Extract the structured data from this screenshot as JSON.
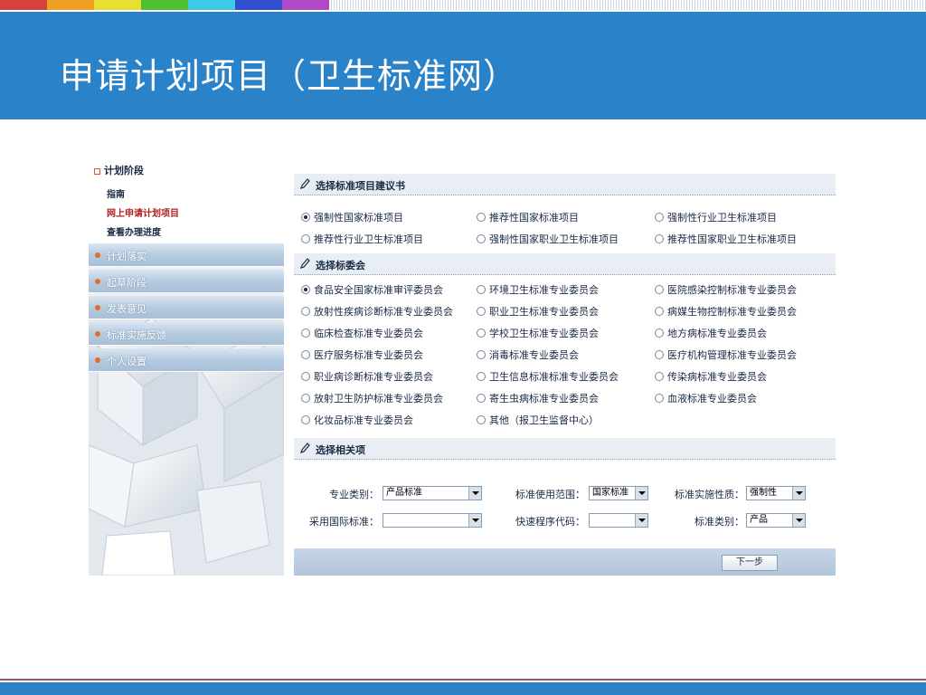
{
  "colors": {
    "header_bg": "#2a82c9",
    "strip": [
      "#d84040",
      "#f0a020",
      "#e8e030",
      "#50c030",
      "#40c8e8",
      "#3050d0",
      "#b048c8"
    ]
  },
  "slide": {
    "title": "申请计划项目（卫生标准网）"
  },
  "nav": {
    "heading": "计划阶段",
    "sub_items": [
      {
        "label": "指南",
        "active": false
      },
      {
        "label": "网上申请计划项目",
        "active": true
      },
      {
        "label": "查看办理进度",
        "active": false
      }
    ],
    "groups": [
      "计划落实",
      "起草阶段",
      "发表意见",
      "标准实施反馈",
      "个人设置"
    ]
  },
  "form": {
    "section1": {
      "title": "选择标准项目建议书",
      "options": [
        {
          "label": "强制性国家标准项目",
          "checked": true
        },
        {
          "label": "推荐性国家标准项目",
          "checked": false
        },
        {
          "label": "强制性行业卫生标准项目",
          "checked": false
        },
        {
          "label": "推荐性行业卫生标准项目",
          "checked": false
        },
        {
          "label": "强制性国家职业卫生标准项目",
          "checked": false
        },
        {
          "label": "推荐性国家职业卫生标准项目",
          "checked": false
        }
      ]
    },
    "section2": {
      "title": "选择标委会",
      "options": [
        {
          "label": "食品安全国家标准审评委员会",
          "checked": true
        },
        {
          "label": "环境卫生标准专业委员会",
          "checked": false
        },
        {
          "label": "医院感染控制标准专业委员会",
          "checked": false
        },
        {
          "label": "放射性疾病诊断标准专业委员会",
          "checked": false
        },
        {
          "label": "职业卫生标准专业委员会",
          "checked": false
        },
        {
          "label": "病媒生物控制标准专业委员会",
          "checked": false
        },
        {
          "label": "临床检查标准专业委员会",
          "checked": false
        },
        {
          "label": "学校卫生标准专业委员会",
          "checked": false
        },
        {
          "label": "地方病标准专业委员会",
          "checked": false
        },
        {
          "label": "医疗服务标准专业委员会",
          "checked": false
        },
        {
          "label": "消毒标准专业委员会",
          "checked": false
        },
        {
          "label": "医疗机构管理标准专业委员会",
          "checked": false
        },
        {
          "label": "职业病诊断标准专业委员会",
          "checked": false
        },
        {
          "label": "卫生信息标准标准专业委员会",
          "checked": false
        },
        {
          "label": "传染病标准专业委员会",
          "checked": false
        },
        {
          "label": "放射卫生防护标准专业委员会",
          "checked": false
        },
        {
          "label": "寄生虫病标准专业委员会",
          "checked": false
        },
        {
          "label": "血液标准专业委员会",
          "checked": false
        },
        {
          "label": "化妆品标准专业委员会",
          "checked": false
        },
        {
          "label": "其他（报卫生监督中心）",
          "checked": false
        }
      ]
    },
    "section3": {
      "title": "选择相关项",
      "fields": [
        {
          "label": "专业类别：",
          "value": "产品标准"
        },
        {
          "label": "标准使用范围：",
          "value": "国家标准"
        },
        {
          "label": "标准实施性质：",
          "value": "强制性"
        },
        {
          "label": "采用国际标准：",
          "value": ""
        },
        {
          "label": "快速程序代码：",
          "value": ""
        },
        {
          "label": "标准类别：",
          "value": "产品"
        }
      ]
    },
    "next_label": "下一步"
  }
}
